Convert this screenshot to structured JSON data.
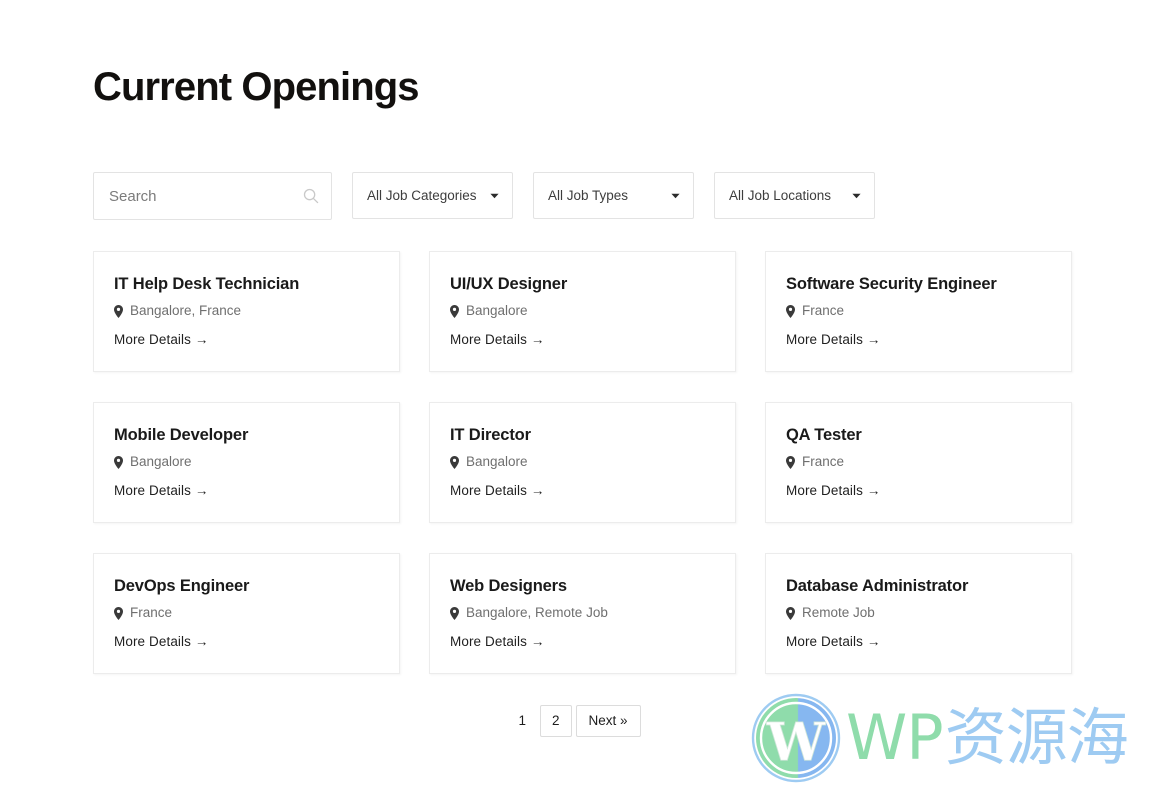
{
  "header": {
    "title": "Current Openings"
  },
  "filters": {
    "search": {
      "placeholder": "Search",
      "value": "",
      "icon": "search-icon"
    },
    "categories": {
      "label": "All Job Categories",
      "icon": "chevron-down-icon"
    },
    "types": {
      "label": "All Job Types",
      "icon": "chevron-down-icon"
    },
    "locations": {
      "label": "All Job Locations",
      "icon": "chevron-down-icon"
    }
  },
  "jobs": {
    "more_details_label": "More Details →",
    "location_icon": "map-pin-icon",
    "items": [
      {
        "title": "IT Help Desk Technician",
        "location": "Bangalore, France",
        "more_details": "More Details →"
      },
      {
        "title": "UI/UX Designer",
        "location": "Bangalore",
        "more_details": "More Details →"
      },
      {
        "title": "Software Security Engineer",
        "location": "France",
        "more_details": "More Details →"
      },
      {
        "title": "Mobile Developer",
        "location": "Bangalore",
        "more_details": "More Details →"
      },
      {
        "title": "IT Director",
        "location": "Bangalore",
        "more_details": "More Details →"
      },
      {
        "title": "QA Tester",
        "location": "France",
        "more_details": "More Details →"
      },
      {
        "title": "DevOps Engineer",
        "location": "France",
        "more_details": "More Details →"
      },
      {
        "title": "Web Designers",
        "location": "Bangalore, Remote Job",
        "more_details": "More Details →"
      },
      {
        "title": "Database Administrator",
        "location": "Remote Job",
        "more_details": "More Details →"
      }
    ]
  },
  "pagination": {
    "current": "1",
    "pages": [
      "2"
    ],
    "next_label": "Next »"
  },
  "watermark": {
    "logo_icon": "wordpress-logo-icon",
    "text_latin": "WP",
    "text_cjk": "资源海",
    "color_latin": "#8fdcab",
    "color_cjk": "#9ecbf2"
  },
  "colors": {
    "background": "#ffffff",
    "title": "#12100e",
    "card_border": "#ececec",
    "field_border": "#e3e3e3",
    "muted_text": "#6f6f6f",
    "body_text": "#1a1a1a"
  }
}
